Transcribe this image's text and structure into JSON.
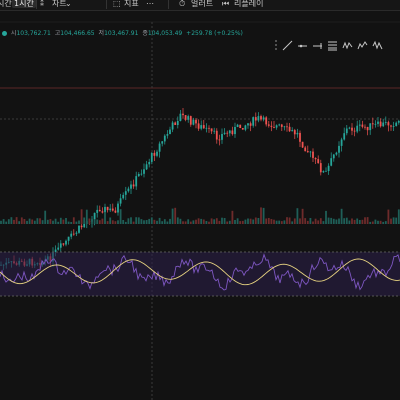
{
  "toolbar": {
    "items": [
      {
        "label": "시간",
        "active": false
      },
      {
        "label": "1시간",
        "active": true
      },
      {
        "label": "차트",
        "active": false
      },
      {
        "label": "지표",
        "active": false
      },
      {
        "label": "얼러트",
        "active": false
      },
      {
        "label": "리플레이",
        "active": false
      }
    ]
  },
  "ohlc": {
    "open_label": "시",
    "open": "103,762.71",
    "high_label": "고",
    "high": "104,466.65",
    "low_label": "저",
    "low": "103,467.91",
    "close_label": "종",
    "close": "104,053.49",
    "change": "+259.78 (+0.25%)"
  },
  "drawing_tools": [
    "trend-line-icon",
    "ray-icon",
    "horizontal-line-icon",
    "fib-retracement-icon",
    "wave-pattern-icon",
    "elliott-wave-icon",
    "zigzag-icon"
  ],
  "colors": {
    "background": "#121212",
    "up": "#26a69a",
    "down": "#ef5350",
    "rsi_line": "#7e57c2",
    "rsi_ma": "#e6d280",
    "rsi_band": "#2b1f4a"
  }
}
